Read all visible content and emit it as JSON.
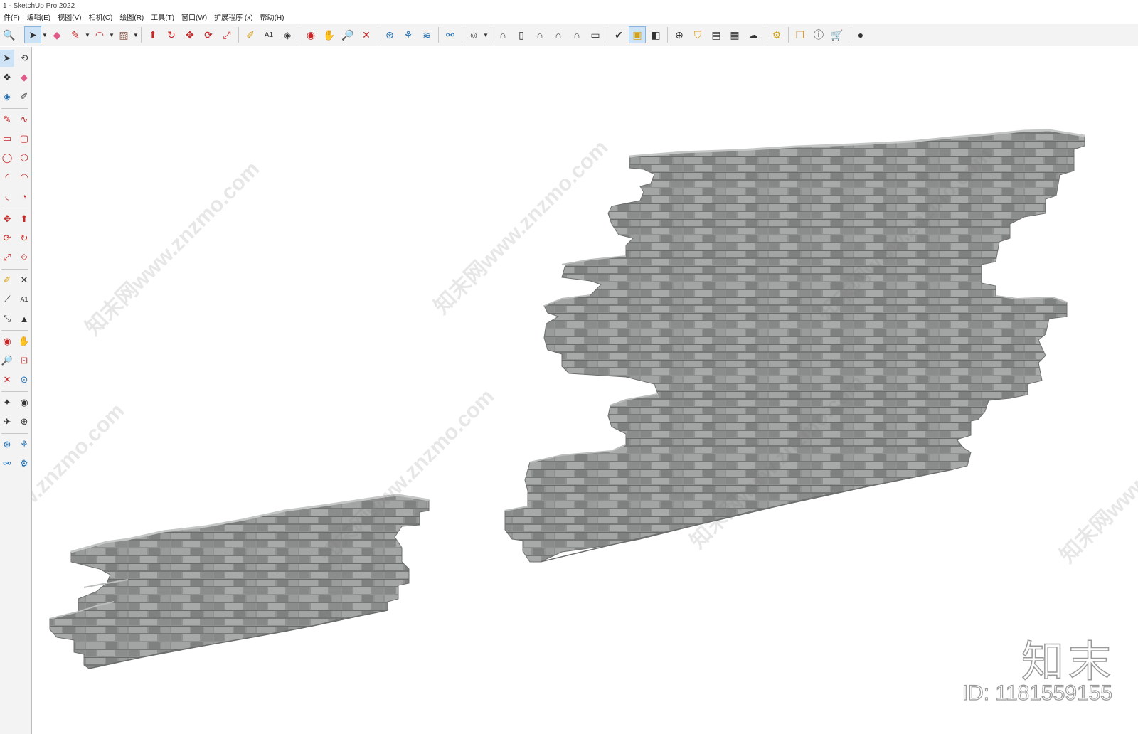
{
  "window": {
    "title": "1 - SketchUp Pro 2022"
  },
  "menu": [
    "件(F)",
    "编辑(E)",
    "视图(V)",
    "相机(C)",
    "绘图(R)",
    "工具(T)",
    "窗口(W)",
    "扩展程序 (x)",
    "帮助(H)"
  ],
  "toolbar": {
    "icons": [
      "zoom-window-icon",
      "select-arrow-icon",
      "eraser-icon",
      "pencil-line-icon",
      "freehand-arc-icon",
      "rectangle-icon",
      "push-pull-icon",
      "follow-me-icon",
      "move-icon",
      "rotate-icon",
      "scale-icon",
      "tape-measure-icon",
      "text-icon",
      "paint-bucket-icon",
      "orbit-icon",
      "pan-icon",
      "zoom-icon",
      "zoom-extents-icon",
      "warehouse-icon",
      "styles-icon",
      "layers-icon",
      "scenes-icon",
      "account-icon",
      "iso-view-icon",
      "front-view-icon",
      "top-view-icon",
      "back-view-icon",
      "left-view-icon",
      "right-view-icon",
      "solid-tools-icon",
      "section-plane-icon",
      "display-section-icon",
      "add-location-icon",
      "shield-icon",
      "classifier-icon",
      "checker-icon",
      "cloud-upload-icon",
      "extension-settings-icon",
      "layout-icon",
      "info-icon",
      "cart-icon",
      "profile-icon"
    ]
  },
  "brand": {
    "logo": "知末",
    "id_text": "ID: 1181559155"
  },
  "watermark": "知末网www.znzmo.com"
}
